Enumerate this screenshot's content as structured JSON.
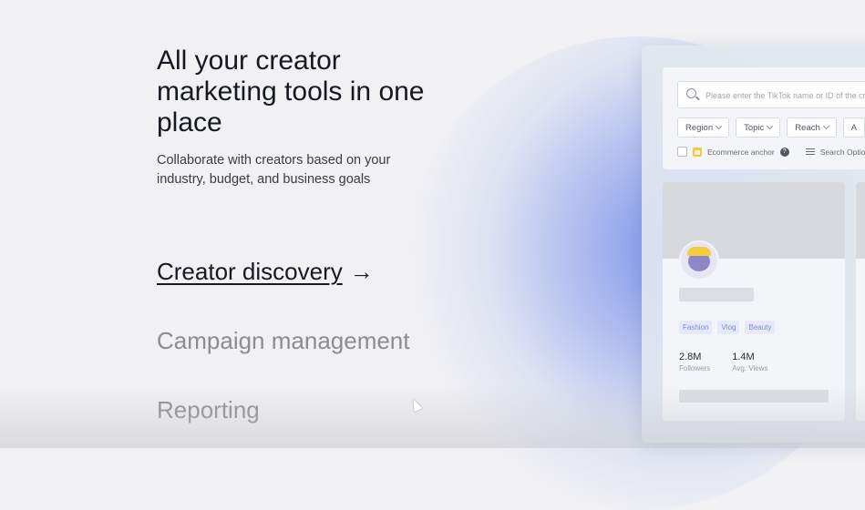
{
  "hero": {
    "title": "All your creator marketing tools in one place",
    "subtitle": "Collaborate with creators based on your industry, budget, and business goals"
  },
  "features": [
    {
      "label": "Creator discovery",
      "active": true,
      "arrow": "→"
    },
    {
      "label": "Campaign management",
      "active": false
    },
    {
      "label": "Reporting",
      "active": false
    }
  ],
  "panel": {
    "search": {
      "placeholder": "Please enter the TikTok name or ID of the creator"
    },
    "filters": [
      {
        "label": "Region"
      },
      {
        "label": "Topic"
      },
      {
        "label": "Reach"
      },
      {
        "label": "A"
      }
    ],
    "options": {
      "ecommerce_label": "Ecommerce anchor",
      "help_glyph": "?",
      "search_options_label": "Search Options"
    },
    "creator": {
      "tags": [
        "Fashion",
        "Vlog",
        "Beauty"
      ],
      "followers_value": "2.8M",
      "followers_label": "Followers",
      "views_value": "1.4M",
      "views_label": "Avg. Views"
    }
  },
  "colors": {
    "accent_glow": "#6080e8",
    "tag_text": "#7c8ad8",
    "text_primary": "#161823",
    "text_muted": "#8b8c93"
  }
}
